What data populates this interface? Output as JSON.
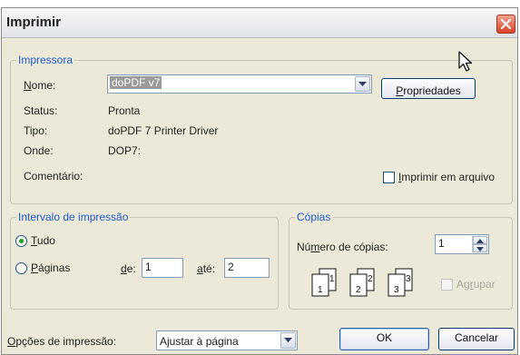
{
  "window": {
    "title": "Imprimir"
  },
  "printer": {
    "group_label": "Impressora",
    "name_label_key": "N",
    "name_label_rest": "ome:",
    "name_value": "doPDF v7",
    "properties_key": "P",
    "properties_rest": "ropriedades",
    "status_label": "Status:",
    "status_value": "Pronta",
    "type_label": "Tipo:",
    "type_value": "doPDF 7 Printer Driver",
    "where_label": "Onde:",
    "where_value": "DOP7:",
    "comment_label": "Comentário:",
    "print_to_file_key": "I",
    "print_to_file_rest": "mprimir em arquivo"
  },
  "range": {
    "group_label": "Intervalo de impressão",
    "all_key": "T",
    "all_rest": "udo",
    "pages_key": "P",
    "pages_rest": "áginas",
    "from_key": "d",
    "from_rest": "e:",
    "from_value": "1",
    "to_key": "a",
    "to_rest": "té:",
    "to_value": "2"
  },
  "copies": {
    "group_label": "Cópias",
    "count_pre": "Nú",
    "count_key": "m",
    "count_post": "ero de cópias:",
    "count_value": "1",
    "collate_pre": "Ag",
    "collate_key": "r",
    "collate_post": "upar",
    "collate_enabled": false,
    "page_icons": [
      "1",
      "1",
      "2",
      "2",
      "3",
      "3"
    ]
  },
  "options": {
    "label_key": "O",
    "label_rest": "pções de impressão:",
    "value": "Ajustar à página"
  },
  "buttons": {
    "ok": "OK",
    "cancel": "Cancelar"
  },
  "colors": {
    "legend": "#1f5ad0",
    "dialog_bg": "#ece9d8",
    "close": "#d8432a"
  },
  "icons": [
    "close-icon",
    "dropdown-arrow-icon",
    "spin-up-icon",
    "spin-down-icon",
    "mouse-cursor-icon",
    "collate-pages-icon"
  ]
}
